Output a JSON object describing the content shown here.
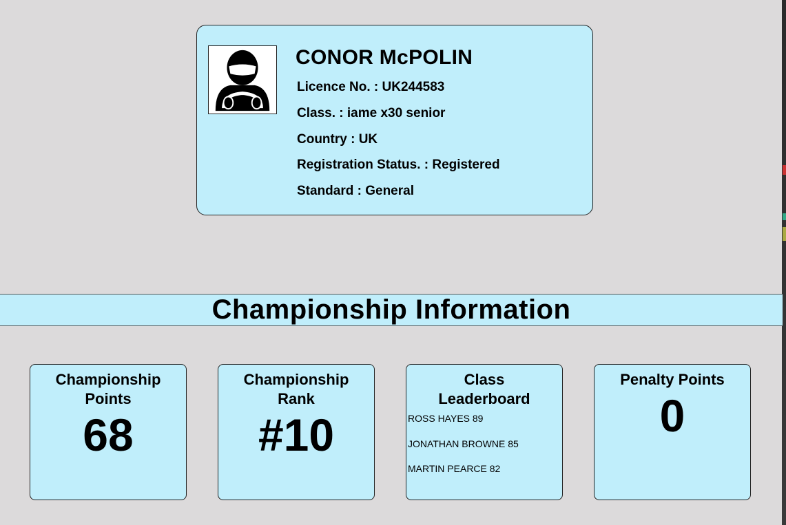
{
  "driver": {
    "name": "CONOR McPOLIN",
    "avatar_icon": "helmeted-driver-icon",
    "licence": "Licence No. : UK244583",
    "class": "Class. : iame x30 senior",
    "country": "Country : UK",
    "registration": "Registration Status. : Registered",
    "standard": "Standard : General"
  },
  "section": {
    "title": "Championship Information"
  },
  "stats": {
    "points": {
      "title": "Championship Points",
      "value": "68"
    },
    "rank": {
      "title": "Championship Rank",
      "value": "#10"
    },
    "leaderboard": {
      "title": "Class Leaderboard",
      "entries": [
        "ROSS HAYES 89",
        "JONATHAN BROWNE 85",
        "MARTIN PEARCE 82"
      ]
    },
    "penalty": {
      "title": "Penalty Points",
      "value": "0"
    }
  },
  "colors": {
    "card_bg": "#c0eefb",
    "page_bg": "#dcdadb"
  }
}
